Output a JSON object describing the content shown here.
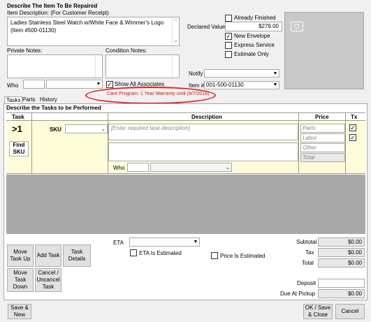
{
  "header": {
    "section_title": "Describe The Item To Be Repaired",
    "item_desc_label": "Item Description: (For Customer Receipt)",
    "item_desc_line1": "Ladies Stainless Steel Watch w/White Face & Wimmer's Logo",
    "item_desc_line2": "(Item #500-01130)",
    "already_finished": "Already Finished",
    "declared_value_label": "Declared Value",
    "declared_value": "$279.00",
    "new_envelope": "New Envelope",
    "express_service": "Express Service",
    "estimate_only": "Estimate Only",
    "private_notes_label": "Private Notes:",
    "condition_notes_label": "Condition Notes:",
    "notify_label": "Notify",
    "who_label": "Who",
    "show_all_associates": "Show All Associates",
    "item_num_label": "Item #",
    "item_num_value": "001-500-01130",
    "care_program": "Care Program: 1 Year Warranty until (9/7/2018)"
  },
  "tabs": [
    "Tasks",
    "Parts",
    "History"
  ],
  "tasks": {
    "section_title": "Describe the Tasks to be Performed",
    "col_task": "Task",
    "col_description": "Description",
    "col_price": "Price",
    "col_tx": "Tx",
    "task_num": ">1",
    "sku_label": "SKU",
    "find_sku": "Find SKU",
    "desc_placeholder": "[Enter required task description]",
    "parts_label": "Parts",
    "labor_label": "Labor",
    "other_label": "Other",
    "total_label": "Total",
    "who_label": "Who"
  },
  "bottom": {
    "eta_label": "ETA",
    "eta_is_estimated": "ETA Is Estimated",
    "price_is_estimated": "Price Is Estimated",
    "subtotal_label": "Subtotal",
    "subtotal_value": "$0.00",
    "tax_label": "Tax",
    "tax_value": "$0.00",
    "total_label": "Total",
    "total_value": "$0.00",
    "deposit_label": "Deposit",
    "due_label": "Due At Pickup",
    "due_value": "$0.00",
    "move_task_up": "Move Task Up",
    "add_task": "Add Task",
    "task_details": "Task Details",
    "move_task_down": "Move Task Down",
    "cancel_uncancel": "Cancel / Uncancel Task"
  },
  "footer": {
    "save_new": "Save & New",
    "ok_save_close": "OK / Save & Close",
    "cancel": "Cancel"
  }
}
